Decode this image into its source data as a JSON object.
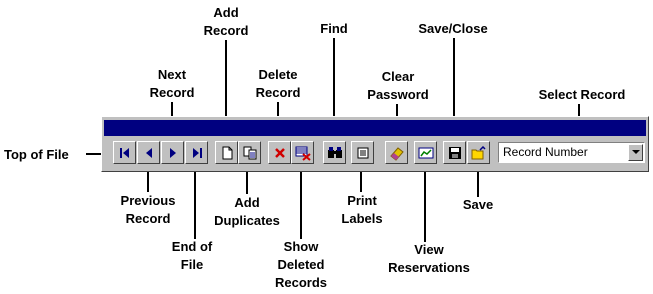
{
  "callouts": {
    "top_of_file": "Top of File",
    "previous_record": [
      "Previous",
      "Record"
    ],
    "next_record": [
      "Next",
      "Record"
    ],
    "end_of_file": [
      "End of",
      "File"
    ],
    "add_record": [
      "Add",
      "Record"
    ],
    "add_duplicates": [
      "Add",
      "Duplicates"
    ],
    "delete_record": [
      "Delete",
      "Record"
    ],
    "show_deleted_records": [
      "Show",
      "Deleted",
      "Records"
    ],
    "find": "Find",
    "print_labels": [
      "Print",
      "Labels"
    ],
    "clear_password": [
      "Clear",
      "Password"
    ],
    "view_reservations": [
      "View",
      "Reservations"
    ],
    "save_close": "Save/Close",
    "save": "Save",
    "select_record": "Select Record"
  },
  "toolbar": {
    "titlebar_color": "#000080",
    "buttons": [
      {
        "name": "top-of-file-button",
        "icon": "first-record-icon"
      },
      {
        "name": "previous-record-button",
        "icon": "previous-record-icon"
      },
      {
        "name": "next-record-button",
        "icon": "next-record-icon"
      },
      {
        "name": "end-of-file-button",
        "icon": "last-record-icon"
      },
      {
        "name": "add-record-button",
        "icon": "new-document-icon"
      },
      {
        "name": "add-duplicates-button",
        "icon": "copy-document-icon"
      },
      {
        "name": "delete-record-button",
        "icon": "red-x-icon"
      },
      {
        "name": "show-deleted-records-button",
        "icon": "deleted-list-icon"
      },
      {
        "name": "find-button",
        "icon": "binoculars-icon"
      },
      {
        "name": "print-labels-button",
        "icon": "labels-icon"
      },
      {
        "name": "clear-password-button",
        "icon": "eraser-icon"
      },
      {
        "name": "view-reservations-button",
        "icon": "chart-icon"
      },
      {
        "name": "save-close-button",
        "icon": "floppy-disk-icon"
      },
      {
        "name": "save-button",
        "icon": "open-folder-icon"
      }
    ],
    "select_record": {
      "value": "Record Number"
    }
  }
}
